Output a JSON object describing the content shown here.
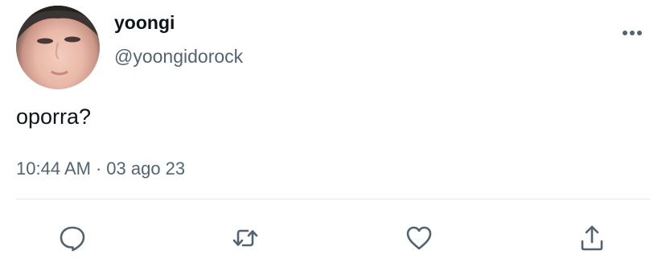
{
  "tweet": {
    "author": {
      "display_name": "yoongi",
      "handle": "@yoongidorock",
      "avatar": "profile-photo"
    },
    "text": "oporra?",
    "time": "10:44 AM",
    "separator": "·",
    "date": "03 ago 23"
  },
  "actions": {
    "more": "more-horizontal-icon",
    "reply": "reply-icon",
    "retweet": "retweet-icon",
    "like": "heart-icon",
    "share": "share-icon"
  },
  "colors": {
    "text_primary": "#0f1419",
    "text_secondary": "#536471",
    "icon": "#536471",
    "divider": "#e3e7ea"
  }
}
